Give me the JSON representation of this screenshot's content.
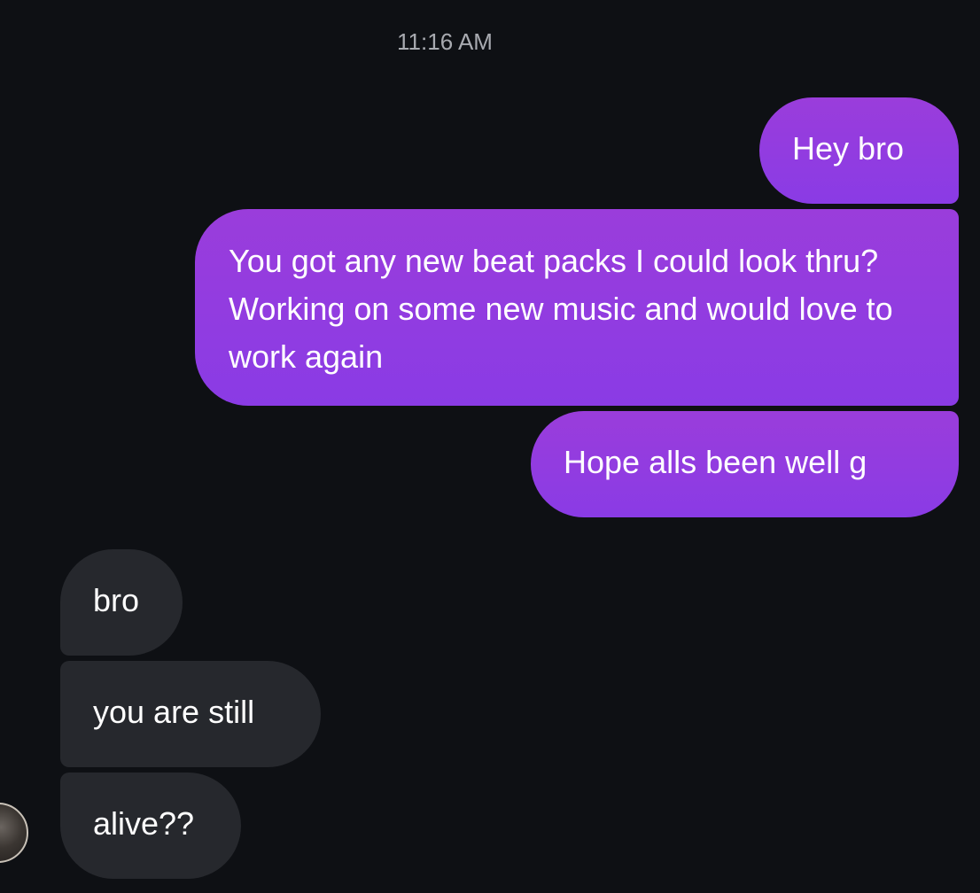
{
  "conversation": {
    "timestamp": "11:16 AM",
    "outgoing": [
      "Hey bro",
      "You got any new beat packs I could look thru? Working on some new music and would love to work again",
      "Hope alls been well g"
    ],
    "incoming": [
      "bro",
      "you are still",
      "alive??"
    ]
  },
  "colors": {
    "background": "#0e1014",
    "outgoing_bubble": "#8e3ce1",
    "incoming_bubble": "#26282d",
    "timestamp_text": "#a8aab0"
  }
}
